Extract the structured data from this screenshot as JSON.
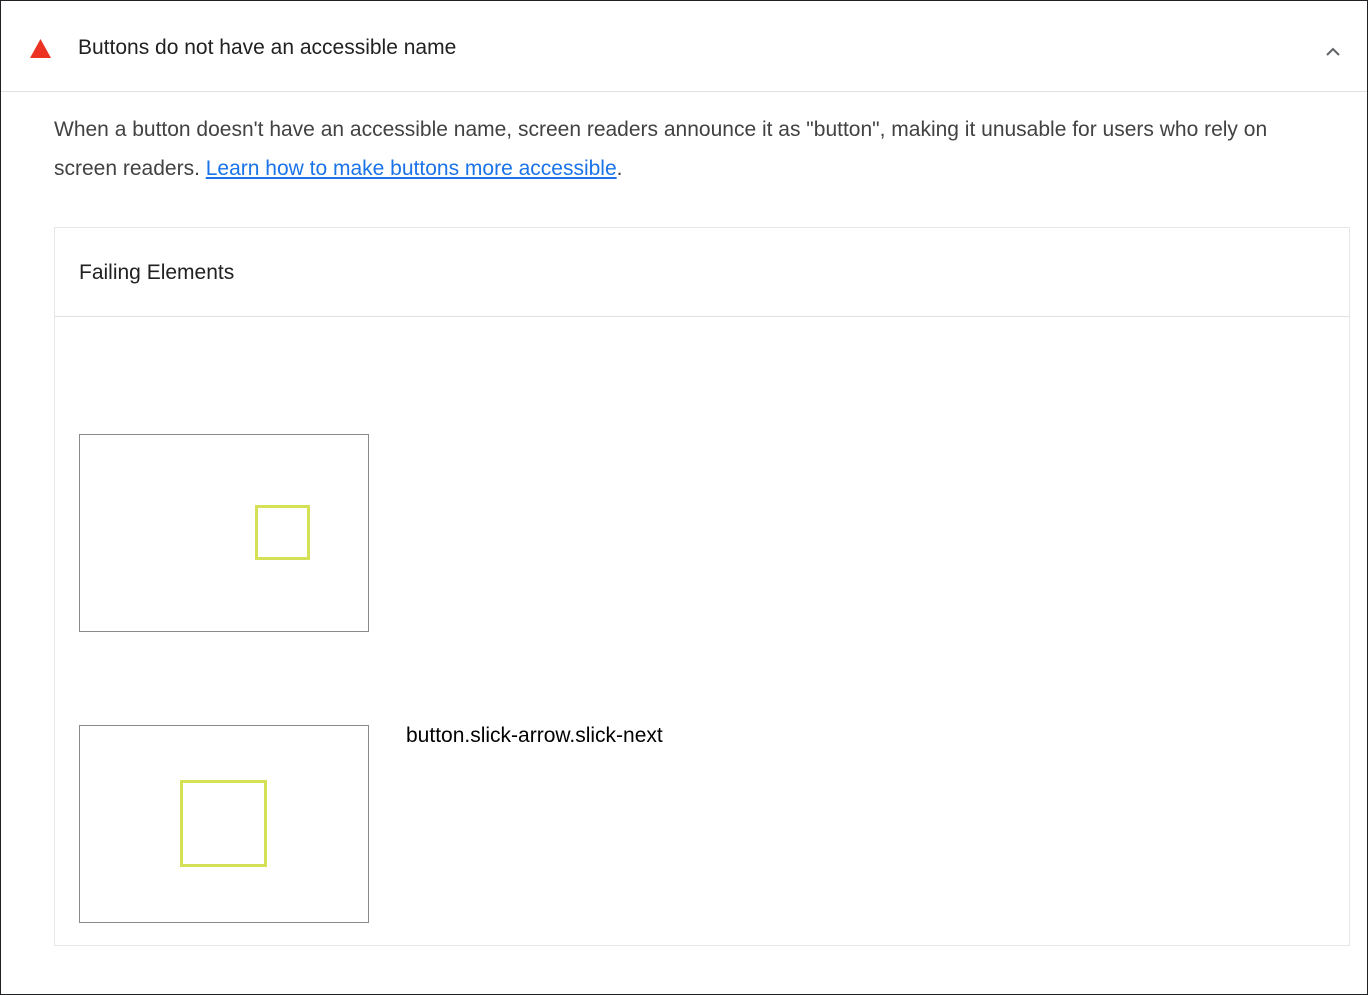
{
  "audit": {
    "status": "fail",
    "title": "Buttons do not have an accessible name",
    "description_text": "When a button doesn't have an accessible name, screen readers announce it as \"button\", making it unusable for users who rely on screen readers. ",
    "learn_more_link": "Learn how to make buttons more accessible",
    "description_end": ".",
    "expanded": true
  },
  "table": {
    "column_header": "Failing Elements",
    "rows": [
      {
        "selector": ""
      },
      {
        "selector": "button.slick-arrow.slick-next"
      }
    ]
  },
  "colors": {
    "fail_icon": "#eb3223",
    "link": "#1a73e8",
    "highlight": "#d4e157"
  },
  "icons": {
    "status_icon": "warning-triangle-icon",
    "toggle_icon": "chevron-up-icon"
  }
}
